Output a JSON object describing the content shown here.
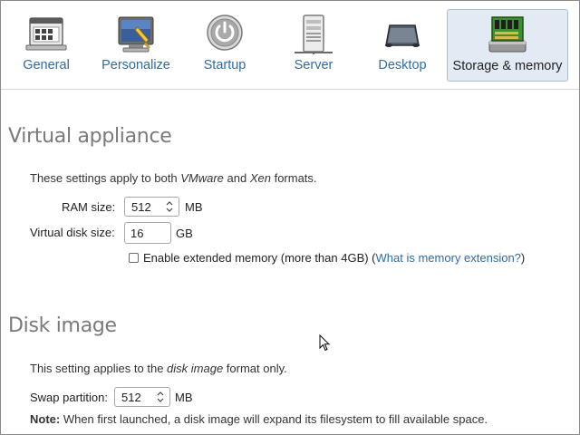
{
  "tabs": [
    {
      "label": "General",
      "icon": "general-settings-icon",
      "active": false
    },
    {
      "label": "Personalize",
      "icon": "personalize-icon",
      "active": false
    },
    {
      "label": "Startup",
      "icon": "power-icon",
      "active": false
    },
    {
      "label": "Server",
      "icon": "server-icon",
      "active": false
    },
    {
      "label": "Desktop",
      "icon": "desktop-icon",
      "active": false
    },
    {
      "label": "Storage & memory",
      "icon": "memory-chip-icon",
      "active": true
    }
  ],
  "virtual_appliance": {
    "title": "Virtual appliance",
    "intro_prefix": "These settings apply to both ",
    "intro_vmware": "VMware",
    "intro_and": " and ",
    "intro_xen": "Xen",
    "intro_suffix": " formats.",
    "ram_label": "RAM size:",
    "ram_value": "512",
    "ram_unit": "MB",
    "disk_label": "Virtual disk size:",
    "disk_value": "16",
    "disk_unit": "GB",
    "extended_memory_label": "Enable extended memory (more than 4GB) (",
    "extended_memory_link": "What is memory extension?",
    "extended_memory_close": ")",
    "extended_memory_checked": false
  },
  "disk_image": {
    "title": "Disk image",
    "intro_prefix": "This setting applies to the ",
    "intro_em": "disk image",
    "intro_suffix": " format only.",
    "swap_label": "Swap partition:",
    "swap_value": "512",
    "swap_unit": "MB",
    "note_label": "Note:",
    "note_text": " When first launched, a disk image will expand its filesystem to fill available space."
  },
  "colors": {
    "link": "#2f6ca3",
    "active_tab_bg": "#e2ebf4",
    "section_title": "#7a7a7a"
  }
}
